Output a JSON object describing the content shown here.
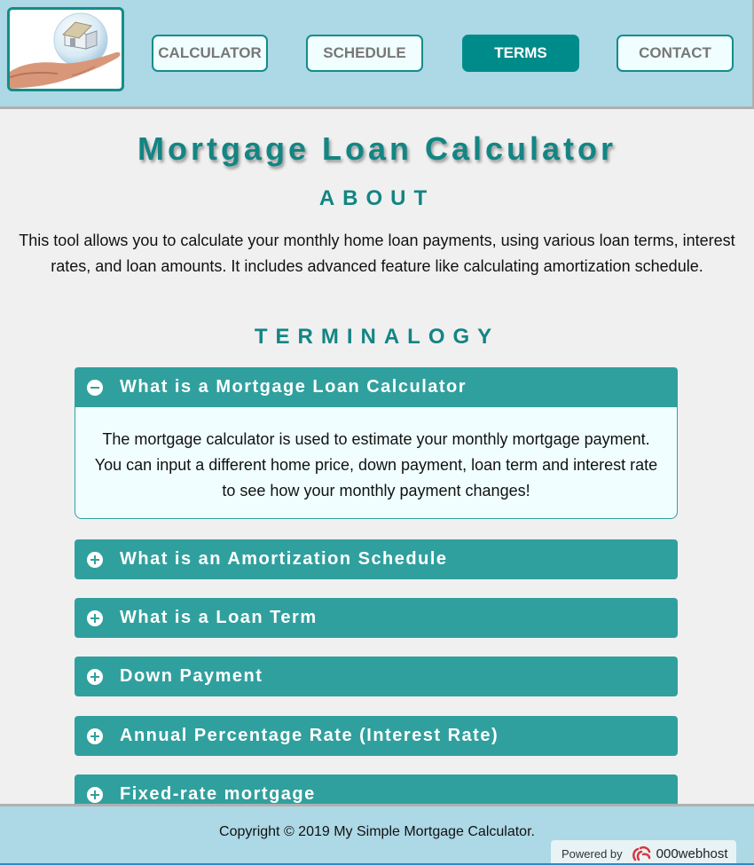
{
  "header": {
    "logo_alt": "hand holding house in bubble",
    "nav": [
      {
        "label": "CALCULATOR",
        "active": false
      },
      {
        "label": "SCHEDULE",
        "active": false
      },
      {
        "label": "TERMS",
        "active": true
      },
      {
        "label": "CONTACT",
        "active": false
      }
    ]
  },
  "main": {
    "title": "Mortgage Loan Calculator",
    "about_heading": "ABOUT",
    "about_text": "This tool allows you to calculate your monthly home loan payments, using various loan terms, interest rates, and loan amounts. It includes advanced feature like calculating amortization schedule.",
    "terminology_heading": "TERMINALOGY",
    "accordion": [
      {
        "title": "What is a Mortgage Loan Calculator",
        "expanded": true,
        "icon": "minus-circle-icon",
        "body": "The mortgage calculator is used to estimate your monthly mortgage payment. You can input a different home price, down payment, loan term and interest rate to see how your monthly payment changes!"
      },
      {
        "title": "What is an Amortization Schedule",
        "expanded": false,
        "icon": "plus-circle-icon"
      },
      {
        "title": "What is a Loan Term",
        "expanded": false,
        "icon": "plus-circle-icon"
      },
      {
        "title": "Down Payment",
        "expanded": false,
        "icon": "plus-circle-icon"
      },
      {
        "title": "Annual Percentage Rate (Interest Rate)",
        "expanded": false,
        "icon": "plus-circle-icon"
      },
      {
        "title": "Fixed-rate mortgage",
        "expanded": false,
        "icon": "plus-circle-icon"
      }
    ]
  },
  "footer": {
    "copyright": "Copyright © 2019 My Simple Mortgage Calculator.",
    "powered_by": "Powered by",
    "host_brand": "000webhost"
  },
  "colors": {
    "header_bg": "#add8e6",
    "accent": "#008b8b",
    "accordion_header": "#30a09e",
    "title": "#138583"
  }
}
